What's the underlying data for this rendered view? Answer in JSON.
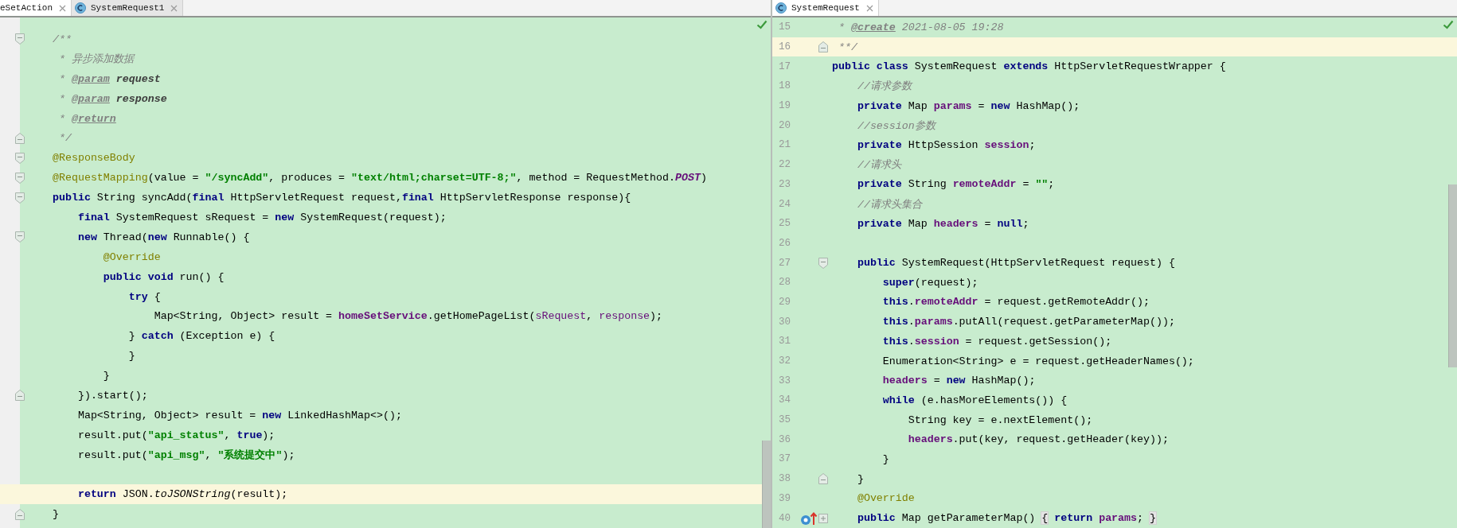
{
  "editors": [
    {
      "tabs": [
        {
          "label": "eSetAction",
          "selected": true,
          "kind": "partial"
        },
        {
          "label": "SystemRequest1",
          "selected": false,
          "kind": "class"
        }
      ],
      "lines": [
        {
          "current": false,
          "kind": "fold_start",
          "tokens": [
            {
              "kind": "comment",
              "text": "/**"
            }
          ]
        },
        {
          "current": false,
          "kind": "code",
          "tokens": [
            {
              "kind": "comment",
              "text": " * 异步添加数据"
            }
          ]
        },
        {
          "current": false,
          "kind": "code",
          "tokens": [
            {
              "kind": "comment",
              "text": " * "
            },
            {
              "kind": "doctag",
              "text": "@param"
            },
            {
              "kind": "docparam",
              "text": " request"
            }
          ]
        },
        {
          "current": false,
          "kind": "code",
          "tokens": [
            {
              "kind": "comment",
              "text": " * "
            },
            {
              "kind": "doctag",
              "text": "@param"
            },
            {
              "kind": "docparam",
              "text": " response"
            }
          ]
        },
        {
          "current": false,
          "kind": "code",
          "tokens": [
            {
              "kind": "comment",
              "text": " * "
            },
            {
              "kind": "doctag",
              "text": "@return"
            }
          ]
        },
        {
          "current": false,
          "kind": "fold_end",
          "tokens": [
            {
              "kind": "comment",
              "text": " */"
            }
          ]
        },
        {
          "current": false,
          "kind": "fold_start",
          "tokens": [
            {
              "kind": "annotation",
              "text": "@ResponseBody"
            }
          ]
        },
        {
          "current": false,
          "kind": "fold_start",
          "tokens": [
            {
              "kind": "annotation",
              "text": "@RequestMapping"
            },
            {
              "kind": "plain",
              "text": "(value = "
            },
            {
              "kind": "string",
              "text": "\"/syncAdd\""
            },
            {
              "kind": "plain",
              "text": ", produces = "
            },
            {
              "kind": "string",
              "text": "\"text/html;charset=UTF-8;\""
            },
            {
              "kind": "plain",
              "text": ", method = RequestMethod."
            },
            {
              "kind": "constant",
              "text": "POST"
            },
            {
              "kind": "plain",
              "text": ")"
            }
          ]
        },
        {
          "current": false,
          "kind": "fold_start",
          "tokens": [
            {
              "kind": "keyword",
              "text": "public"
            },
            {
              "kind": "plain",
              "text": " String syncAdd("
            },
            {
              "kind": "keyword",
              "text": "final"
            },
            {
              "kind": "plain",
              "text": " HttpServletRequest request,"
            },
            {
              "kind": "keyword",
              "text": "final"
            },
            {
              "kind": "plain",
              "text": " HttpServletResponse response){"
            }
          ]
        },
        {
          "current": false,
          "kind": "code",
          "tokens": [
            {
              "kind": "keyword",
              "text": "    final"
            },
            {
              "kind": "plain",
              "text": " SystemRequest sRequest = "
            },
            {
              "kind": "keyword",
              "text": "new"
            },
            {
              "kind": "plain",
              "text": " SystemRequest(request);"
            }
          ]
        },
        {
          "current": false,
          "kind": "fold_start",
          "tokens": [
            {
              "kind": "keyword",
              "text": "    new"
            },
            {
              "kind": "plain",
              "text": " Thread("
            },
            {
              "kind": "keyword",
              "text": "new"
            },
            {
              "kind": "plain",
              "text": " Runnable() {"
            }
          ]
        },
        {
          "current": false,
          "kind": "code",
          "tokens": [
            {
              "kind": "annotation",
              "text": "        @Override"
            }
          ]
        },
        {
          "current": false,
          "kind": "code",
          "tokens": [
            {
              "kind": "keyword",
              "text": "        public void"
            },
            {
              "kind": "plain",
              "text": " run() {"
            }
          ]
        },
        {
          "current": false,
          "kind": "code",
          "tokens": [
            {
              "kind": "keyword",
              "text": "            try"
            },
            {
              "kind": "plain",
              "text": " {"
            }
          ]
        },
        {
          "current": false,
          "kind": "code",
          "tokens": [
            {
              "kind": "plain",
              "text": "                Map<String, Object> result = "
            },
            {
              "kind": "field",
              "text": "homeSetService"
            },
            {
              "kind": "plain",
              "text": ".getHomePageList("
            },
            {
              "kind": "param",
              "text": "sRequest"
            },
            {
              "kind": "plain",
              "text": ", "
            },
            {
              "kind": "param",
              "text": "response"
            },
            {
              "kind": "plain",
              "text": ");"
            }
          ]
        },
        {
          "current": false,
          "kind": "code",
          "tokens": [
            {
              "kind": "plain",
              "text": "            } "
            },
            {
              "kind": "keyword",
              "text": "catch"
            },
            {
              "kind": "plain",
              "text": " (Exception e) {"
            }
          ]
        },
        {
          "current": false,
          "kind": "code",
          "tokens": [
            {
              "kind": "plain",
              "text": "            }"
            }
          ]
        },
        {
          "current": false,
          "kind": "code",
          "tokens": [
            {
              "kind": "plain",
              "text": "        }"
            }
          ]
        },
        {
          "current": false,
          "kind": "fold_end",
          "tokens": [
            {
              "kind": "plain",
              "text": "    }).start();"
            }
          ]
        },
        {
          "current": false,
          "kind": "code",
          "tokens": [
            {
              "kind": "plain",
              "text": "    Map<String, Object> result = "
            },
            {
              "kind": "keyword",
              "text": "new"
            },
            {
              "kind": "plain",
              "text": " LinkedHashMap<>();"
            }
          ]
        },
        {
          "current": false,
          "kind": "code",
          "tokens": [
            {
              "kind": "plain",
              "text": "    result.put("
            },
            {
              "kind": "string",
              "text": "\"api_status\""
            },
            {
              "kind": "plain",
              "text": ", "
            },
            {
              "kind": "keyword",
              "text": "true"
            },
            {
              "kind": "plain",
              "text": ");"
            }
          ]
        },
        {
          "current": false,
          "kind": "code",
          "tokens": [
            {
              "kind": "plain",
              "text": "    result.put("
            },
            {
              "kind": "string",
              "text": "\"api_msg\""
            },
            {
              "kind": "plain",
              "text": ", "
            },
            {
              "kind": "string",
              "text": "\"系统提交中\""
            },
            {
              "kind": "plain",
              "text": ");"
            }
          ]
        },
        {
          "current": false,
          "kind": "code"
        },
        {
          "current": true,
          "kind": "code",
          "tokens": [
            {
              "kind": "keyword",
              "text": "    return"
            },
            {
              "kind": "plain",
              "text": " JSON."
            },
            {
              "kind": "static",
              "text": "toJSONString"
            },
            {
              "kind": "plain",
              "text": "(result);"
            }
          ]
        },
        {
          "current": false,
          "kind": "fold_end",
          "tokens": [
            {
              "kind": "plain",
              "text": "}"
            }
          ]
        }
      ]
    },
    {
      "tabs": [
        {
          "label": "SystemRequest",
          "selected": true,
          "kind": "class"
        }
      ],
      "lines": [
        {
          "number": "15",
          "current": false,
          "kind": "code",
          "tokens": [
            {
              "kind": "comment",
              "text": " * "
            },
            {
              "kind": "doctag",
              "text": "@create"
            },
            {
              "kind": "comment",
              "text": " 2021-08-05 19:28"
            }
          ]
        },
        {
          "number": "16",
          "current": true,
          "kind": "fold_end",
          "tokens": [
            {
              "kind": "comment",
              "text": " **/"
            }
          ]
        },
        {
          "number": "17",
          "current": false,
          "kind": "code",
          "tokens": [
            {
              "kind": "keyword",
              "text": "public class"
            },
            {
              "kind": "plain",
              "text": " SystemRequest "
            },
            {
              "kind": "keyword",
              "text": "extends"
            },
            {
              "kind": "plain",
              "text": " HttpServletRequestWrapper {"
            }
          ]
        },
        {
          "number": "18",
          "current": false,
          "kind": "code",
          "tokens": [
            {
              "kind": "comment",
              "text": "    //请求参数"
            }
          ]
        },
        {
          "number": "19",
          "current": false,
          "kind": "code",
          "tokens": [
            {
              "kind": "keyword",
              "text": "    private"
            },
            {
              "kind": "plain",
              "text": " Map "
            },
            {
              "kind": "field",
              "text": "params"
            },
            {
              "kind": "plain",
              "text": " = "
            },
            {
              "kind": "keyword",
              "text": "new"
            },
            {
              "kind": "plain",
              "text": " HashMap();"
            }
          ]
        },
        {
          "number": "20",
          "current": false,
          "kind": "code",
          "tokens": [
            {
              "kind": "comment",
              "text": "    //session参数"
            }
          ]
        },
        {
          "number": "21",
          "current": false,
          "kind": "code",
          "tokens": [
            {
              "kind": "keyword",
              "text": "    private"
            },
            {
              "kind": "plain",
              "text": " HttpSession "
            },
            {
              "kind": "field",
              "text": "session"
            },
            {
              "kind": "plain",
              "text": ";"
            }
          ]
        },
        {
          "number": "22",
          "current": false,
          "kind": "code",
          "tokens": [
            {
              "kind": "comment",
              "text": "    //请求头"
            }
          ]
        },
        {
          "number": "23",
          "current": false,
          "kind": "code",
          "tokens": [
            {
              "kind": "keyword",
              "text": "    private"
            },
            {
              "kind": "plain",
              "text": " String "
            },
            {
              "kind": "field",
              "text": "remoteAddr"
            },
            {
              "kind": "plain",
              "text": " = "
            },
            {
              "kind": "string",
              "text": "\"\""
            },
            {
              "kind": "plain",
              "text": ";"
            }
          ]
        },
        {
          "number": "24",
          "current": false,
          "kind": "code",
          "tokens": [
            {
              "kind": "comment",
              "text": "    //请求头集合"
            }
          ]
        },
        {
          "number": "25",
          "current": false,
          "kind": "code",
          "tokens": [
            {
              "kind": "keyword",
              "text": "    private"
            },
            {
              "kind": "plain",
              "text": " Map "
            },
            {
              "kind": "field",
              "text": "headers"
            },
            {
              "kind": "plain",
              "text": " = "
            },
            {
              "kind": "keyword",
              "text": "null"
            },
            {
              "kind": "plain",
              "text": ";"
            }
          ]
        },
        {
          "number": "26",
          "current": false,
          "kind": "code"
        },
        {
          "number": "27",
          "current": false,
          "kind": "fold_start",
          "tokens": [
            {
              "kind": "keyword",
              "text": "    public"
            },
            {
              "kind": "plain",
              "text": " SystemRequest(HttpServletRequest request) {"
            }
          ]
        },
        {
          "number": "28",
          "current": false,
          "kind": "code",
          "tokens": [
            {
              "kind": "keyword",
              "text": "        super"
            },
            {
              "kind": "plain",
              "text": "(request);"
            }
          ]
        },
        {
          "number": "29",
          "current": false,
          "kind": "code",
          "tokens": [
            {
              "kind": "keyword",
              "text": "        this"
            },
            {
              "kind": "plain",
              "text": "."
            },
            {
              "kind": "field",
              "text": "remoteAddr"
            },
            {
              "kind": "plain",
              "text": " = request.getRemoteAddr();"
            }
          ]
        },
        {
          "number": "30",
          "current": false,
          "kind": "code",
          "tokens": [
            {
              "kind": "keyword",
              "text": "        this"
            },
            {
              "kind": "plain",
              "text": "."
            },
            {
              "kind": "field",
              "text": "params"
            },
            {
              "kind": "plain",
              "text": ".putAll(request.getParameterMap());"
            }
          ]
        },
        {
          "number": "31",
          "current": false,
          "kind": "code",
          "tokens": [
            {
              "kind": "keyword",
              "text": "        this"
            },
            {
              "kind": "plain",
              "text": "."
            },
            {
              "kind": "field",
              "text": "session"
            },
            {
              "kind": "plain",
              "text": " = request.getSession();"
            }
          ]
        },
        {
          "number": "32",
          "current": false,
          "kind": "code",
          "tokens": [
            {
              "kind": "plain",
              "text": "        Enumeration<String> e = request.getHeaderNames();"
            }
          ]
        },
        {
          "number": "33",
          "current": false,
          "kind": "code",
          "tokens": [
            {
              "kind": "field",
              "text": "        headers"
            },
            {
              "kind": "plain",
              "text": " = "
            },
            {
              "kind": "keyword",
              "text": "new"
            },
            {
              "kind": "plain",
              "text": " HashMap();"
            }
          ]
        },
        {
          "number": "34",
          "current": false,
          "kind": "code",
          "tokens": [
            {
              "kind": "keyword",
              "text": "        while"
            },
            {
              "kind": "plain",
              "text": " (e.hasMoreElements()) {"
            }
          ]
        },
        {
          "number": "35",
          "current": false,
          "kind": "code",
          "tokens": [
            {
              "kind": "plain",
              "text": "            String key = e.nextElement();"
            }
          ]
        },
        {
          "number": "36",
          "current": false,
          "kind": "code",
          "tokens": [
            {
              "kind": "field",
              "text": "            headers"
            },
            {
              "kind": "plain",
              "text": ".put(key, request.getHeader(key));"
            }
          ]
        },
        {
          "number": "37",
          "current": false,
          "kind": "code",
          "tokens": [
            {
              "kind": "plain",
              "text": "        }"
            }
          ]
        },
        {
          "number": "38",
          "current": false,
          "kind": "fold_end",
          "tokens": [
            {
              "kind": "plain",
              "text": "    }"
            }
          ]
        },
        {
          "number": "39",
          "current": false,
          "kind": "code",
          "tokens": [
            {
              "kind": "annotation",
              "text": "    @Override"
            }
          ]
        },
        {
          "number": "40",
          "current": false,
          "kind": "override_collapsed",
          "tokens": [
            {
              "kind": "keyword",
              "text": "    public"
            },
            {
              "kind": "plain",
              "text": " Map getParameterMap() "
            },
            {
              "kind": "folded",
              "text": "{"
            },
            {
              "kind": "keyword",
              "text": " return"
            },
            {
              "kind": "field",
              "text": " params"
            },
            {
              "kind": "plain",
              "text": "; "
            },
            {
              "kind": "folded",
              "text": "}"
            }
          ]
        }
      ]
    }
  ]
}
